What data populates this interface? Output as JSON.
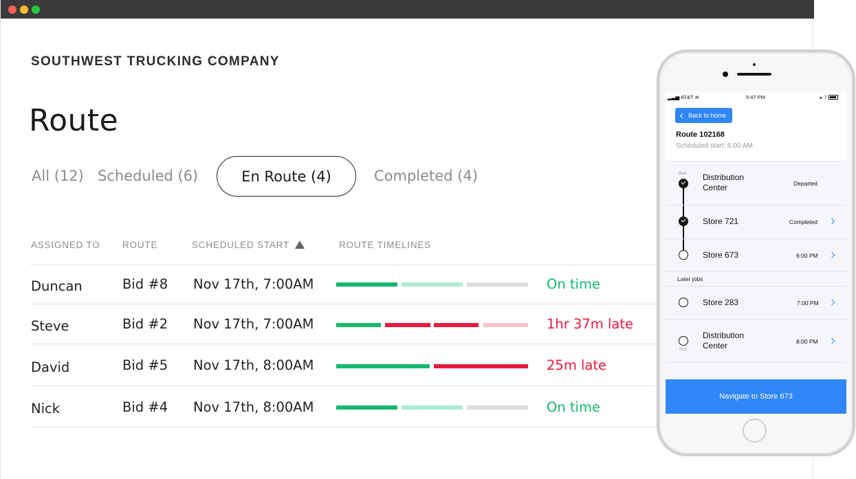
{
  "window": {
    "colors": {
      "titlebar": "#3b3b3b",
      "close": "#ff5f57",
      "minimize": "#febc2e",
      "maximize": "#28c840"
    }
  },
  "company": "SOUTHWEST TRUCKING COMPANY",
  "page_title": "Route",
  "tabs": [
    {
      "label": "All (12)",
      "active": false
    },
    {
      "label": "Scheduled (6)",
      "active": false
    },
    {
      "label": "En Route (4)",
      "active": true
    },
    {
      "label": "Completed (4)",
      "active": false
    }
  ],
  "table": {
    "headers": [
      "ASSIGNED TO",
      "ROUTE",
      "SCHEDULED START",
      "ROUTE TIMELINES"
    ],
    "sort_column": "SCHEDULED START",
    "sort_icon": "triangle-up-icon",
    "rows": [
      {
        "assigned_to": "Duncan",
        "route": "Bid #8",
        "scheduled_start": "Nov 17th, 7:00AM",
        "status": "On time",
        "status_color": "#14b86e",
        "timeline": [
          {
            "color": "#14b86e"
          },
          {
            "color": "#aeeccf"
          },
          {
            "color": "#dddddd"
          }
        ]
      },
      {
        "assigned_to": "Steve",
        "route": "Bid #2",
        "scheduled_start": "Nov 17th, 7:00AM",
        "status": "1hr 37m late",
        "status_color": "#e8193c",
        "timeline": [
          {
            "color": "#14b86e"
          },
          {
            "color": "#e8193c"
          },
          {
            "color": "#e8193c"
          },
          {
            "color": "#f8c3c9"
          }
        ]
      },
      {
        "assigned_to": "David",
        "route": "Bid #5",
        "scheduled_start": "Nov 17th, 8:00AM",
        "status": "25m late",
        "status_color": "#e8193c",
        "timeline": [
          {
            "color": "#14b86e"
          },
          {
            "color": "#e8193c"
          }
        ]
      },
      {
        "assigned_to": "Nick",
        "route": "Bid #4",
        "scheduled_start": "Nov 17th, 8:00AM",
        "status": "On time",
        "status_color": "#14b86e",
        "timeline": [
          {
            "color": "#14b86e"
          },
          {
            "color": "#aeeccf"
          },
          {
            "color": "#dddddd"
          }
        ]
      }
    ]
  },
  "phone": {
    "status_bar": {
      "carrier": "AT&T",
      "time": "5:47 PM"
    },
    "back_label": "Back to home",
    "route_title": "Route 102168",
    "route_subtitle": "Scheduled start: 6:00 AM",
    "start_label": "Start",
    "end_label": "End",
    "later_jobs_label": "Later jobs",
    "stops": [
      {
        "name_line1": "Distribution",
        "name_line2": "Center",
        "status": "Departed",
        "state": "done"
      },
      {
        "name_line1": "Store 721",
        "name_line2": "",
        "status": "Completed",
        "state": "done"
      },
      {
        "name_line1": "Store 673",
        "name_line2": "",
        "status": "6:00 PM",
        "state": "pending"
      },
      {
        "name_line1": "Store 283",
        "name_line2": "",
        "status": "7:00 PM",
        "state": "pending"
      },
      {
        "name_line1": "Distribution",
        "name_line2": "Center",
        "status": "8:00 PM",
        "state": "pending"
      }
    ],
    "navigate_label": "Navigate to Store 673",
    "accent_color": "#2f86f6"
  }
}
